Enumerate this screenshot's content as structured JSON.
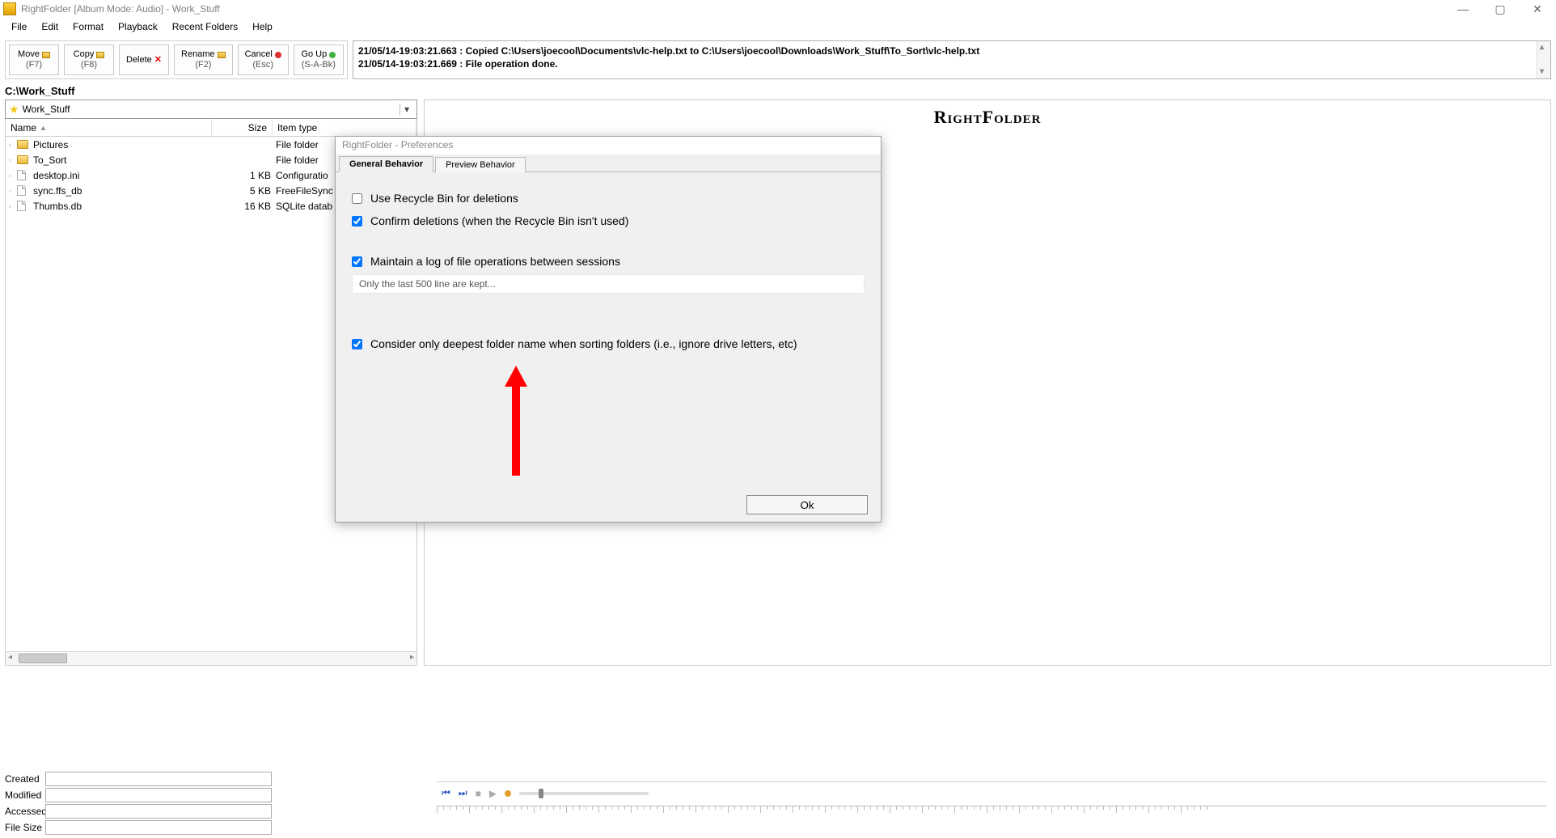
{
  "window": {
    "title": "RightFolder [Album Mode: Audio] - Work_Stuff"
  },
  "menu": {
    "file": "File",
    "edit": "Edit",
    "format": "Format",
    "playback": "Playback",
    "recent": "Recent Folders",
    "help": "Help"
  },
  "toolbar": {
    "move": {
      "label": "Move",
      "sub": "(F7)"
    },
    "copy": {
      "label": "Copy",
      "sub": "(F8)"
    },
    "delete": {
      "label": "Delete",
      "sub": ""
    },
    "rename": {
      "label": "Rename",
      "sub": "(F2)"
    },
    "cancel": {
      "label": "Cancel",
      "sub": "(Esc)"
    },
    "goup": {
      "label": "Go Up",
      "sub": "(S-A-Bk)"
    }
  },
  "log": {
    "line1": "21/05/14-19:03:21.663 : Copied C:\\Users\\joecool\\Documents\\vlc-help.txt to C:\\Users\\joecool\\Downloads\\Work_Stuff\\To_Sort\\vlc-help.txt",
    "line2": "21/05/14-19:03:21.669 : File operation done."
  },
  "path": "C:\\Work_Stuff",
  "combo": {
    "value": "Work_Stuff"
  },
  "columns": {
    "name": "Name",
    "size": "Size",
    "type": "Item type"
  },
  "files": [
    {
      "name": "Pictures",
      "size": "",
      "type": "File folder",
      "kind": "folder"
    },
    {
      "name": "To_Sort",
      "size": "",
      "type": "File folder",
      "kind": "folder"
    },
    {
      "name": "desktop.ini",
      "size": "1 KB",
      "type": "Configuratio",
      "kind": "file"
    },
    {
      "name": "sync.ffs_db",
      "size": "5 KB",
      "type": "FreeFileSync",
      "kind": "file"
    },
    {
      "name": "Thumbs.db",
      "size": "16 KB",
      "type": "SQLite datab",
      "kind": "file"
    }
  ],
  "brand": "RightFolder",
  "props": {
    "created": "Created",
    "modified": "Modified",
    "accessed": "Accessed",
    "filesize": "File Size"
  },
  "dialog": {
    "title": "RightFolder - Preferences",
    "tab1": "General Behavior",
    "tab2": "Preview Behavior",
    "opt1": "Use Recycle Bin for deletions",
    "opt2": "Confirm deletions (when the Recycle Bin isn't used)",
    "opt3": "Maintain a log of file operations between sessions",
    "note": "Only the last 500 line are kept...",
    "opt4": "Consider only deepest folder name when sorting folders (i.e., ignore drive letters, etc)",
    "ok": "Ok"
  }
}
